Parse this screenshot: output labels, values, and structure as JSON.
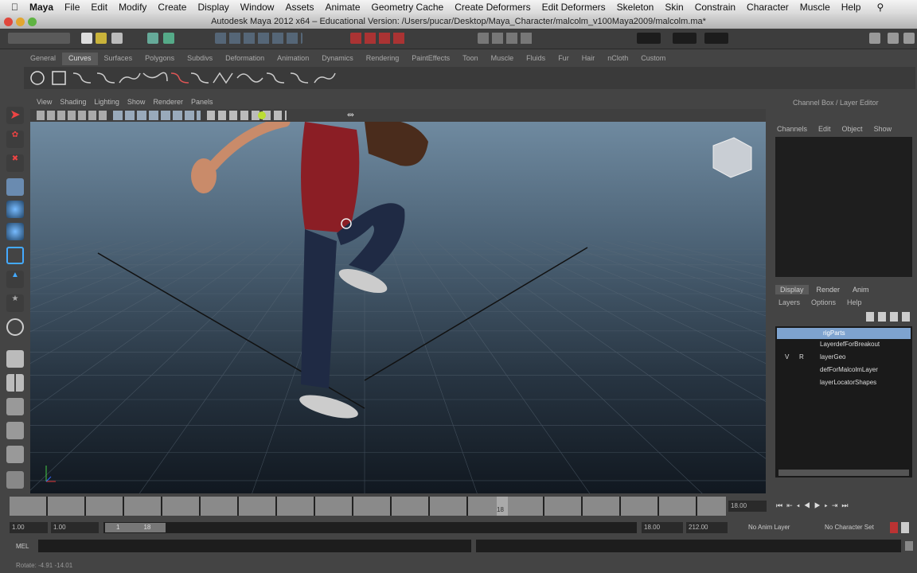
{
  "mac_menu": [
    "Maya",
    "File",
    "Edit",
    "Modify",
    "Create",
    "Display",
    "Window",
    "Assets",
    "Animate",
    "Geometry Cache",
    "Create Deformers",
    "Edit Deformers",
    "Skeleton",
    "Skin",
    "Constrain",
    "Character",
    "Muscle",
    "Help"
  ],
  "window_title": "Autodesk Maya 2012 x64 – Educational Version: /Users/pucar/Desktop/Maya_Character/malcolm_v100Maya2009/malcolm.ma*",
  "shelf_tabs": [
    "General",
    "Curves",
    "Surfaces",
    "Polygons",
    "Subdivs",
    "Deformation",
    "Animation",
    "Dynamics",
    "Rendering",
    "PaintEffects",
    "Toon",
    "Muscle",
    "Fluids",
    "Fur",
    "Hair",
    "nCloth",
    "Custom"
  ],
  "active_shelf": "Curves",
  "viewport_menu": [
    "View",
    "Shading",
    "Lighting",
    "Show",
    "Renderer",
    "Panels"
  ],
  "channel_box": {
    "title": "Channel Box / Layer Editor",
    "menu": [
      "Channels",
      "Edit",
      "Object",
      "Show"
    ]
  },
  "layer_editor": {
    "tabs": [
      "Display",
      "Render",
      "Anim"
    ],
    "menu": [
      "Layers",
      "Options",
      "Help"
    ],
    "layers": [
      {
        "name": "rigParts",
        "selected": true,
        "v": "",
        "p": ""
      },
      {
        "name": "LayerdefForBreakout",
        "v": "",
        "p": ""
      },
      {
        "name": "layerGeo",
        "v": "V",
        "p": "R"
      },
      {
        "name": "defForMalcolmLayer",
        "v": "",
        "p": ""
      },
      {
        "name": "layerLocatorShapes",
        "v": "",
        "p": ""
      }
    ]
  },
  "timeline": {
    "current_frame": "18.00",
    "marker": "18"
  },
  "range": {
    "start": "1.00",
    "playback_start": "1.00",
    "slider_start": "1",
    "slider_end": "18",
    "playback_end": "18.00",
    "end": "212.00"
  },
  "anim_layer": "No Anim Layer",
  "character_set": "No Character Set",
  "command_label": "MEL",
  "help_line": "Rotate:  -4.91   -14.01",
  "colors": {
    "selected_layer": "#7ea3cf",
    "timeline": "#8a8a8a"
  }
}
